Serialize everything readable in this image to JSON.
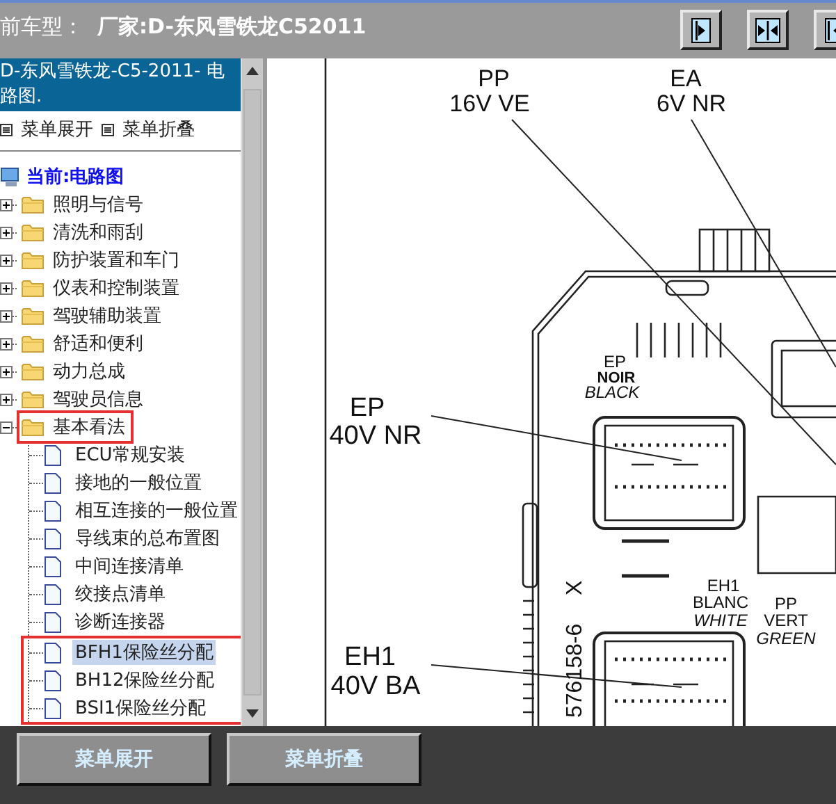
{
  "header": {
    "label": "前车型：",
    "model": "厂家:D-东风雪铁龙C52011"
  },
  "toolbar": [
    {
      "kind": "right"
    },
    {
      "kind": "inward"
    },
    {
      "kind": "left"
    }
  ],
  "sidebar": {
    "title": "D-东风雪铁龙-C5-2011- 电路图.",
    "links": [
      "菜单展开",
      "菜单折叠"
    ],
    "root": "当前:电路图",
    "items": [
      {
        "label": "照明与信号",
        "expanded": false,
        "marked": false
      },
      {
        "label": "清洗和雨刮",
        "expanded": false,
        "marked": false
      },
      {
        "label": "防护装置和车门",
        "expanded": false,
        "marked": false
      },
      {
        "label": "仪表和控制装置",
        "expanded": false,
        "marked": false
      },
      {
        "label": "驾驶辅助装置",
        "expanded": false,
        "marked": false
      },
      {
        "label": "舒适和便利",
        "expanded": false,
        "marked": false
      },
      {
        "label": "动力总成",
        "expanded": false,
        "marked": false
      },
      {
        "label": "驾驶员信息",
        "expanded": false,
        "marked": false
      },
      {
        "label": "基本看法",
        "expanded": true,
        "marked": true,
        "children": [
          {
            "label": "ECU常规安装",
            "selected": false,
            "marked": false
          },
          {
            "label": "接地的一般位置",
            "selected": false,
            "marked": false
          },
          {
            "label": "相互连接的一般位置",
            "selected": false,
            "marked": false
          },
          {
            "label": "导线束的总布置图",
            "selected": false,
            "marked": false
          },
          {
            "label": "中间连接清单",
            "selected": false,
            "marked": false
          },
          {
            "label": "绞接点清单",
            "selected": false,
            "marked": false
          },
          {
            "label": "诊断连接器",
            "selected": false,
            "marked": false
          },
          {
            "label": "BFH1保险丝分配",
            "selected": true,
            "marked": true
          },
          {
            "label": "BH12保险丝分配",
            "selected": false,
            "marked": true
          },
          {
            "label": "BSI1保险丝分配",
            "selected": false,
            "marked": true
          }
        ]
      }
    ]
  },
  "diagram": {
    "labels": [
      "PP",
      "16V VE",
      "EA",
      "6V NR",
      "EP",
      "NOIR",
      "BLACK",
      "EP",
      "40V NR",
      "EH1",
      "BLANC",
      "WHITE",
      "PP",
      "VERT",
      "GREEN",
      "EH1",
      "40V BA",
      "576158-6",
      "X"
    ]
  },
  "bottom_buttons": [
    "菜单展开",
    "菜单折叠"
  ]
}
